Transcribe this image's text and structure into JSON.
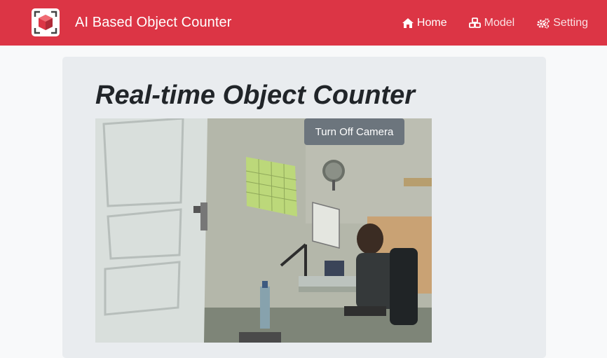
{
  "navbar": {
    "brand_text": "AI Based Object Counter",
    "brand_icon": "cube-icon",
    "bg_color": "#dc3545",
    "items": [
      {
        "label": "Home",
        "icon": "home-icon",
        "active": true
      },
      {
        "label": "Model",
        "icon": "cubes-icon",
        "active": false
      },
      {
        "label": "Setting",
        "icon": "cogs-icon",
        "active": false
      }
    ]
  },
  "main": {
    "title": "Real-time Object Counter",
    "camera_button_label": "Turn Off Camera",
    "video_feed": "live-camera-feed"
  }
}
